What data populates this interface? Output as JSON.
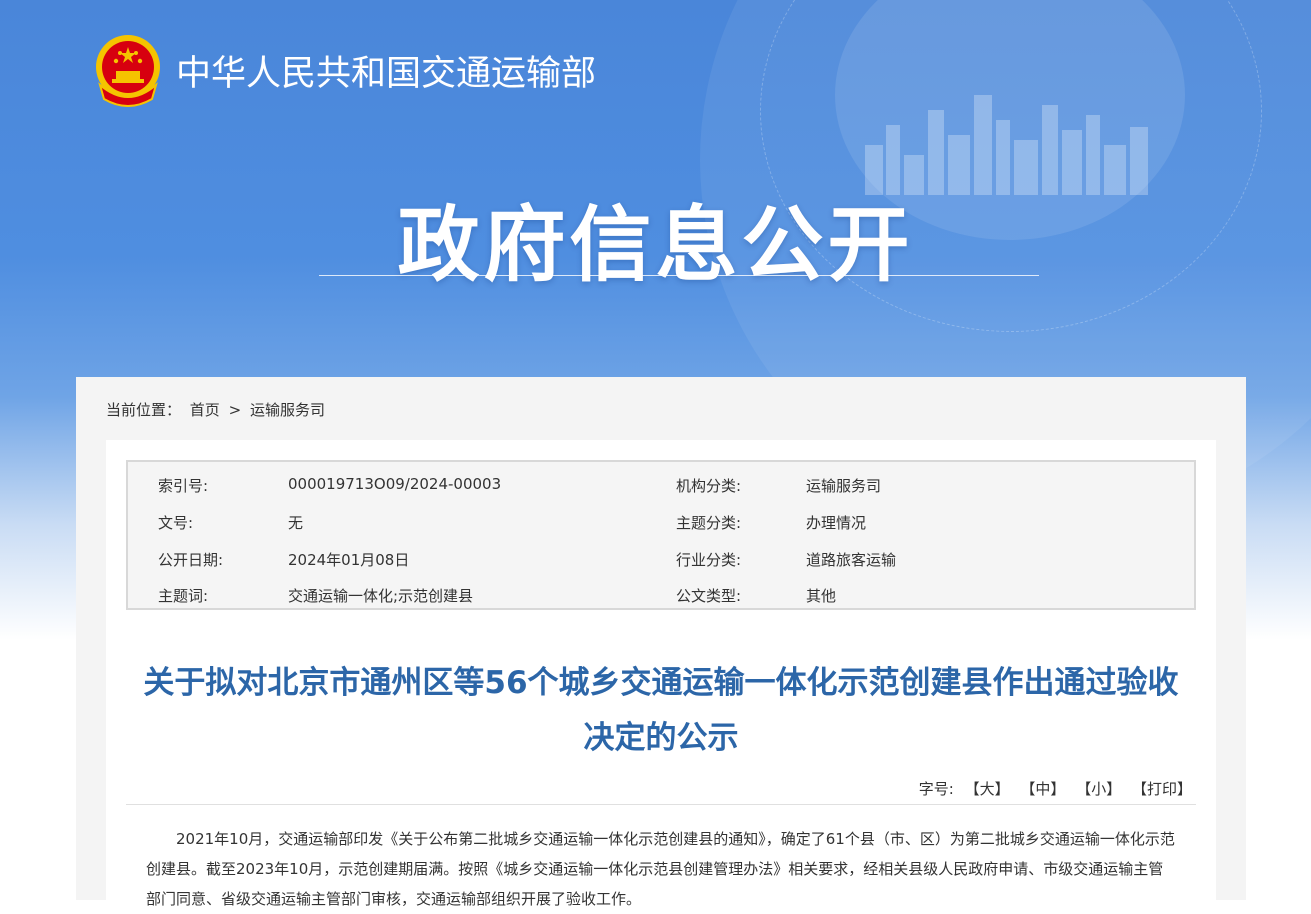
{
  "header": {
    "ministry_name": "中华人民共和国交通运输部",
    "banner_title": "政府信息公开"
  },
  "breadcrumb": {
    "prefix": "当前位置：",
    "home": "首页",
    "separator": ">",
    "current": "运输服务司"
  },
  "meta": {
    "rows": [
      {
        "label1": "索引号:",
        "value1": "000019713O09/2024-00003",
        "label2": "机构分类:",
        "value2": "运输服务司"
      },
      {
        "label1": "文号:",
        "value1": "无",
        "label2": "主题分类:",
        "value2": "办理情况"
      },
      {
        "label1": "公开日期:",
        "value1": "2024年01月08日",
        "label2": "行业分类:",
        "value2": "道路旅客运输"
      },
      {
        "label1": "主题词:",
        "value1": "交通运输一体化;示范创建县",
        "label2": "公文类型:",
        "value2": "其他"
      }
    ]
  },
  "article": {
    "title_line1": "关于拟对北京市通州区等56个城乡交通运输一体化示范创建县作出通过验收",
    "title_line2": "决定的公示",
    "font_label": "字号:",
    "font_large": "【大】",
    "font_medium": "【中】",
    "font_small": "【小】",
    "print": "【打印】",
    "body": "2021年10月，交通运输部印发《关于公布第二批城乡交通运输一体化示范创建县的通知》，确定了61个县（市、区）为第二批城乡交通运输一体化示范创建县。截至2023年10月，示范创建期届满。按照《城乡交通运输一体化示范县创建管理办法》相关要求，经相关县级人民政府申请、市级交通运输主管部门同意、省级交通运输主管部门审核，交通运输部组织开展了验收工作。"
  },
  "colors": {
    "banner_blue": "#4a86d9",
    "title_blue": "#2c66a8",
    "emblem_red": "#d7000f",
    "emblem_gold": "#f5c400"
  }
}
